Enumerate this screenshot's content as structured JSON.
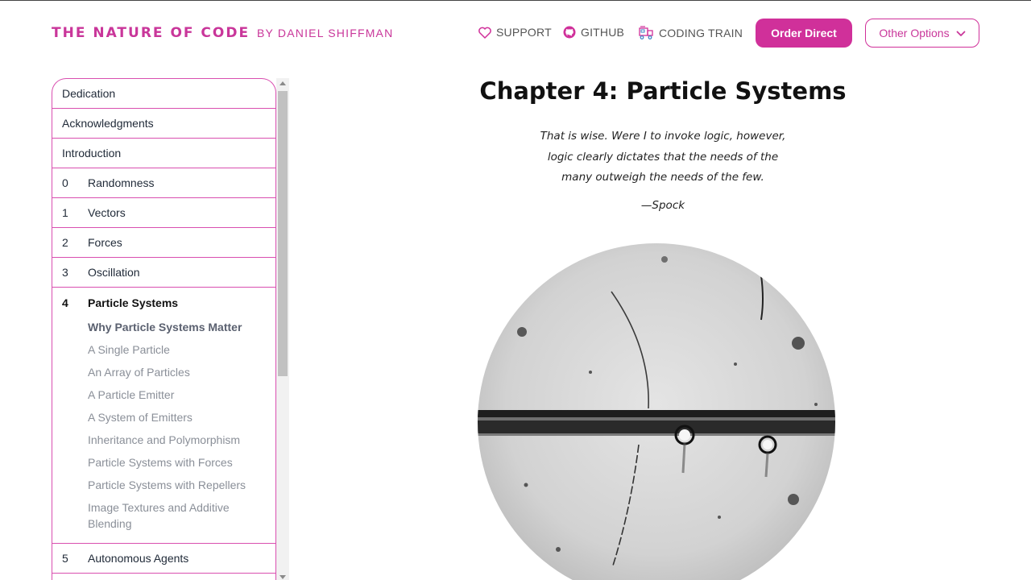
{
  "header": {
    "brand": "THE NATURE OF CODE",
    "byline": "BY DANIEL SHIFFMAN",
    "links": [
      {
        "label": "SUPPORT",
        "icon": "heart-icon"
      },
      {
        "label": "GITHUB",
        "icon": "github-icon"
      },
      {
        "label": "CODING TRAIN",
        "icon": "coding-train-icon"
      }
    ],
    "order_button": "Order Direct",
    "other_options_button": "Other Options"
  },
  "sidebar": {
    "front_matter": [
      "Dedication",
      "Acknowledgments",
      "Introduction"
    ],
    "chapters_before": [
      {
        "num": "0",
        "title": "Randomness"
      },
      {
        "num": "1",
        "title": "Vectors"
      },
      {
        "num": "2",
        "title": "Forces"
      },
      {
        "num": "3",
        "title": "Oscillation"
      }
    ],
    "active_chapter": {
      "num": "4",
      "title": "Particle Systems"
    },
    "sections": [
      "Why Particle Systems Matter",
      "A Single Particle",
      "An Array of Particles",
      "A Particle Emitter",
      "A System of Emitters",
      "Inheritance and Polymorphism",
      "Particle Systems with Forces",
      "Particle Systems with Repellers",
      "Image Textures and Additive Blending"
    ],
    "chapters_after": [
      {
        "num": "5",
        "title": "Autonomous Agents"
      }
    ]
  },
  "main": {
    "chapter_title": "Chapter 4: Particle Systems",
    "quote_lines": [
      "That is wise. Were I to invoke logic, however,",
      "logic clearly dictates that the needs of the",
      "many outweigh the needs of the few."
    ],
    "quote_author": "—Spock"
  },
  "colors": {
    "accent": "#d0309a",
    "border": "#d94fb0"
  }
}
